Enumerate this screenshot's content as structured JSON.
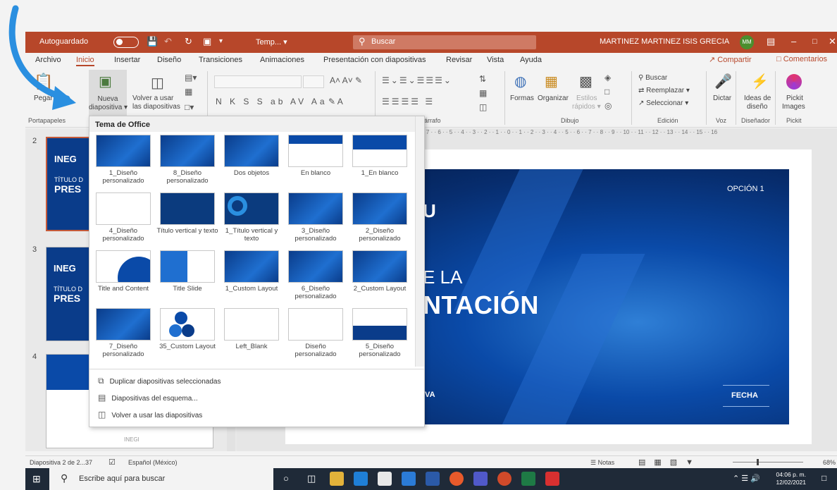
{
  "titlebar": {
    "autosave": "Autoguardado",
    "doc_title": "Temp... ▾",
    "search_placeholder": "Buscar",
    "user_name": "MARTINEZ MARTINEZ ISIS GRECIA",
    "user_initials": "MM"
  },
  "tabs": [
    "Archivo",
    "Inicio",
    "Insertar",
    "Diseño",
    "Transiciones",
    "Animaciones",
    "Presentación con diapositivas",
    "Revisar",
    "Vista",
    "Ayuda"
  ],
  "share": {
    "compartir": "Compartir",
    "comentarios": "Comentarios"
  },
  "ribbon": {
    "pegar": "Pegar",
    "nueva_1": "Nueva",
    "nueva_2": "diapositiva ▾",
    "volver_1": "Volver a usar",
    "volver_2": "las diapositivas",
    "formas": "Formas",
    "organizar": "Organizar",
    "estilos_1": "Estilos",
    "estilos_2": "rápidos ▾",
    "buscar": "Buscar",
    "reemplazar": "Reemplazar ▾",
    "seleccionar": "Seleccionar ▾",
    "dictar": "Dictar",
    "ideas_1": "Ideas de",
    "ideas_2": "diseño",
    "pickit_1": "Pickit",
    "pickit_2": "Images",
    "g_portapapeles": "Portapapeles",
    "g_parrafo": "Párrafo",
    "g_dibujo": "Dibujo",
    "g_edicion": "Edición",
    "g_voz": "Voz",
    "g_disenador": "Diseñador",
    "g_pickit": "Pickit"
  },
  "gallery": {
    "header": "Tema de Office",
    "layouts": [
      {
        "name": "1_Diseño personalizado",
        "style": "blue"
      },
      {
        "name": "8_Diseño personalizado",
        "style": "blue"
      },
      {
        "name": "Dos objetos",
        "style": "blue"
      },
      {
        "name": "En blanco",
        "style": "whitebar"
      },
      {
        "name": "1_En blanco",
        "style": "bluebar"
      },
      {
        "name": "4_Diseño personalizado",
        "style": "white"
      },
      {
        "name": "Título vertical y texto",
        "style": "navy"
      },
      {
        "name": "1_Título vertical y texto",
        "style": "circle"
      },
      {
        "name": "3_Diseño personalizado",
        "style": "blue"
      },
      {
        "name": "2_Diseño personalizado",
        "style": "blue"
      },
      {
        "name": "Title and Content",
        "style": "arc"
      },
      {
        "name": "Title Slide",
        "style": "half"
      },
      {
        "name": "1_Custom Layout",
        "style": "blue"
      },
      {
        "name": "6_Diseño personalizado",
        "style": "blue"
      },
      {
        "name": "2_Custom Layout",
        "style": "blue"
      },
      {
        "name": "7_Diseño personalizado",
        "style": "blue"
      },
      {
        "name": "35_Custom Layout",
        "style": "dots"
      },
      {
        "name": "Left_Blank",
        "style": "white"
      },
      {
        "name": "Diseño personalizado",
        "style": "white"
      },
      {
        "name": "5_Diseño personalizado",
        "style": "bottombar"
      }
    ],
    "cmd_duplicar": "Duplicar diapositivas seleccionadas",
    "cmd_esquema": "Diapositivas del esquema...",
    "cmd_volver": "Volver a usar las diapositivas"
  },
  "slides": {
    "numbers": [
      "2",
      "3",
      "4"
    ],
    "logo": "INEG",
    "titulo": "TÍTULO D",
    "pres": "PRES",
    "footer_logo": "INEGI"
  },
  "slide": {
    "opcion": "OPCIÓN 1",
    "big_u": "U",
    "el": "E LA",
    "ntacion": "NTACIÓN",
    "iva": "IVA",
    "fecha": "FECHA"
  },
  "ruler": "· 7 · · 6 · · 5 · · 4 · · 3 · · 2 · · 1 · · 0 · · 1 · · 2 · · 3 · · 4 · · 5 · · 6 · · 7 · · 8 · · 9 · · 10 · · 11 · · 12 · · 13 · · 14 · · 15 · · 16",
  "status": {
    "slide_count": "Diapositiva 2 de 2...37",
    "language": "Español (México)",
    "notas": "Notas",
    "zoom": "68%"
  },
  "taskbar": {
    "search_placeholder": "Escribe aquí para buscar",
    "time": "04:06 p. m.",
    "date": "12/02/2021"
  },
  "colors": {
    "accent": "#b7472a",
    "slide_blue": "#0a4aa8",
    "taskbar": "#1f2a38"
  }
}
